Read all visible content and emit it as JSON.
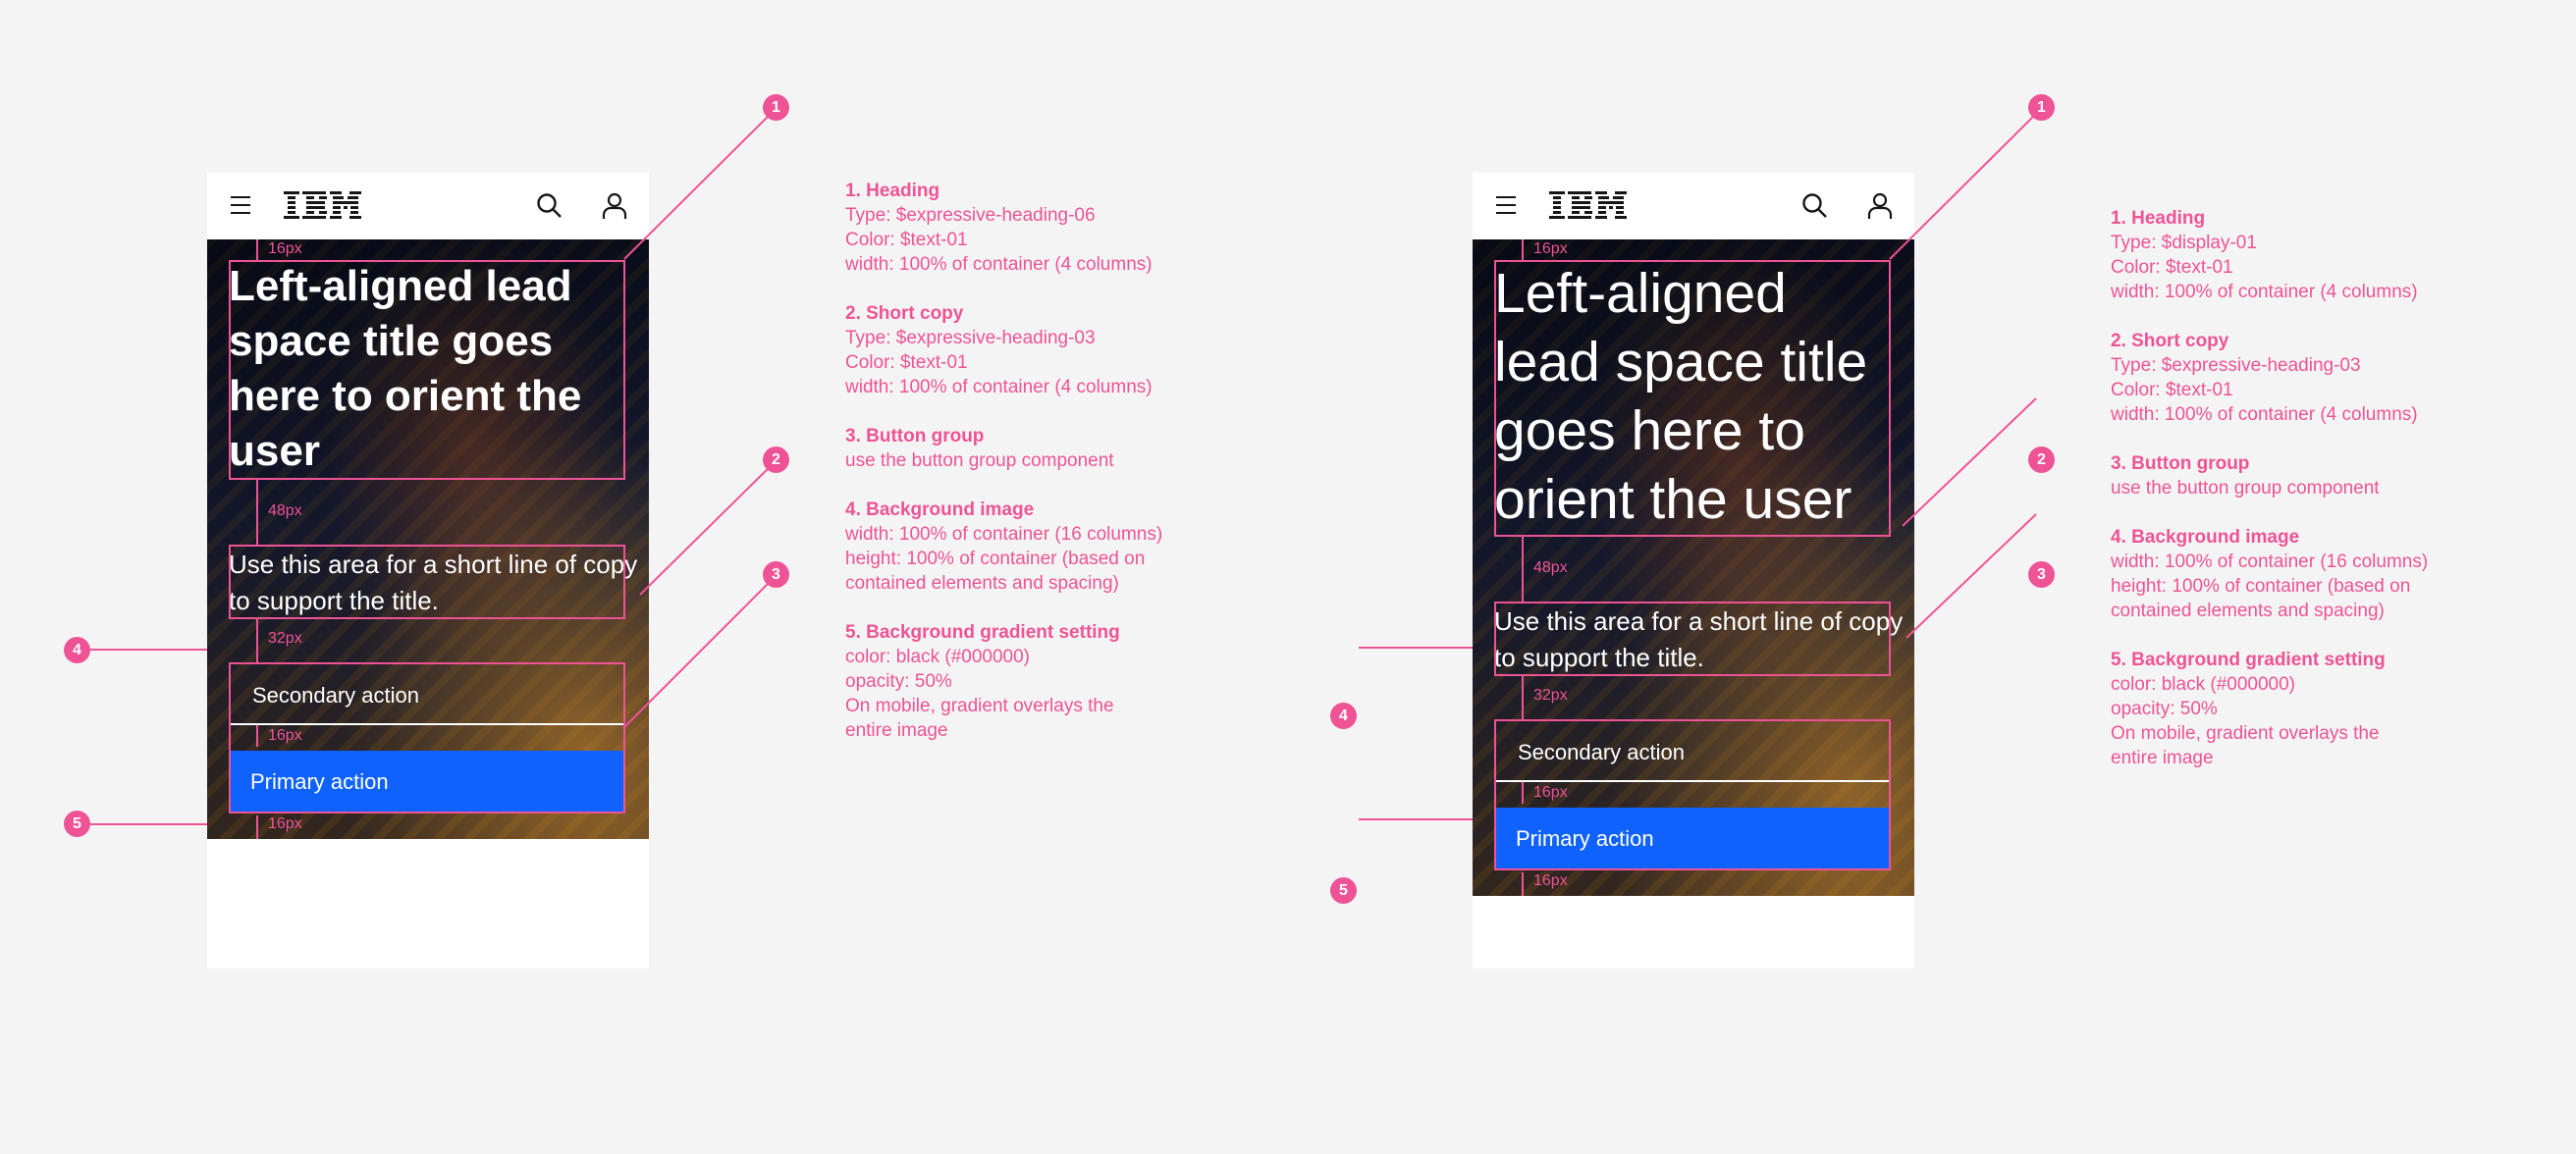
{
  "colors": {
    "annotation": "#ee5396",
    "primary_button": "#0f62fe",
    "background": "#f4f4f4"
  },
  "variants": [
    {
      "logo": "IBM",
      "title": "Left-aligned lead space title goes here to orient the user",
      "copy": "Use this area for a short line of copy to support the title.",
      "secondary_action": "Secondary action",
      "primary_action": "Primary action",
      "spacing": [
        "16px",
        "48px",
        "32px",
        "16px",
        "16px"
      ],
      "notes": [
        {
          "heading": "1. Heading",
          "lines": [
            "Type: $expressive-heading-06",
            "Color: $text-01",
            "width: 100% of container (4 columns)"
          ]
        },
        {
          "heading": "2. Short copy",
          "lines": [
            "Type: $expressive-heading-03",
            "Color: $text-01",
            "width: 100% of container (4 columns)"
          ]
        },
        {
          "heading": "3. Button group",
          "lines": [
            "use the button group component"
          ]
        },
        {
          "heading": "4. Background image",
          "lines": [
            "width: 100% of container (16 columns)",
            "height: 100% of container (based on",
            "contained elements and spacing)"
          ]
        },
        {
          "heading": "5. Background gradient setting",
          "lines": [
            "color: black (#000000)",
            "opacity: 50%",
            "On mobile, gradient overlays the",
            "entire image"
          ]
        }
      ]
    },
    {
      "logo": "IBM",
      "title": "Left-aligned lead space title goes here to orient the user",
      "copy": "Use this area for a short line of copy to support the title.",
      "secondary_action": "Secondary action",
      "primary_action": "Primary action",
      "spacing": [
        "16px",
        "48px",
        "32px",
        "16px",
        "16px"
      ],
      "notes": [
        {
          "heading": "1. Heading",
          "lines": [
            "Type: $display-01",
            "Color: $text-01",
            "width: 100% of container (4 columns)"
          ]
        },
        {
          "heading": "2. Short copy",
          "lines": [
            "Type: $expressive-heading-03",
            "Color: $text-01",
            "width: 100% of container (4 columns)"
          ]
        },
        {
          "heading": "3. Button group",
          "lines": [
            "use the button group component"
          ]
        },
        {
          "heading": "4. Background image",
          "lines": [
            "width: 100% of container (16 columns)",
            "height: 100% of container (based on",
            "contained elements and spacing)"
          ]
        },
        {
          "heading": "5. Background gradient setting",
          "lines": [
            "color: black (#000000)",
            "opacity: 50%",
            "On mobile, gradient overlays the",
            "entire image"
          ]
        }
      ]
    }
  ],
  "badges": [
    "1",
    "2",
    "3",
    "4",
    "5"
  ]
}
